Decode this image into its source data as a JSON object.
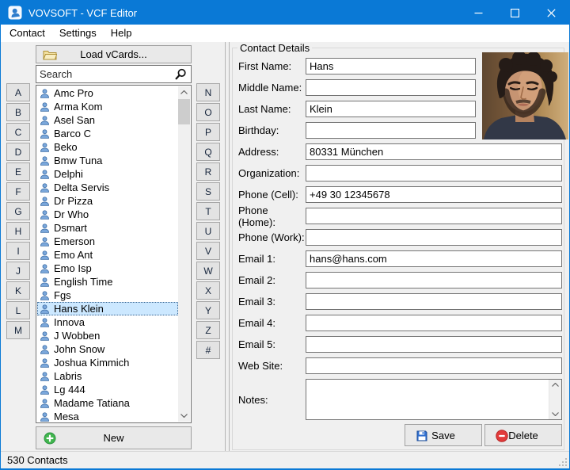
{
  "window": {
    "title": "VOVSOFT - VCF Editor",
    "accent_color": "#0a79d6"
  },
  "menu": {
    "items": [
      {
        "label": "Contact"
      },
      {
        "label": "Settings"
      },
      {
        "label": "Help"
      }
    ]
  },
  "sidebar": {
    "load_button": "Load vCards...",
    "search_placeholder": "Search",
    "new_button": "New",
    "alphabet_left": [
      "A",
      "B",
      "C",
      "D",
      "E",
      "F",
      "G",
      "H",
      "I",
      "J",
      "K",
      "L",
      "M"
    ],
    "alphabet_right": [
      "N",
      "O",
      "P",
      "Q",
      "R",
      "S",
      "T",
      "U",
      "V",
      "W",
      "X",
      "Y",
      "Z",
      "#"
    ]
  },
  "contacts": {
    "selected": "Hans Klein",
    "next_row_partial": true,
    "items": [
      "Amc Pro",
      "Arma Kom",
      "Asel San",
      "Barco C",
      "Beko",
      "Bmw Tuna",
      "Delphi",
      "Delta Servis",
      "Dr Pizza",
      "Dr Who",
      "Dsmart",
      "Emerson",
      "Emo Ant",
      "Emo Isp",
      "English Time",
      "Fgs",
      "Hans Klein",
      "Innova",
      "J Wobben",
      "John Snow",
      "Joshua Kimmich",
      "Labris",
      "Lg 444",
      "Madame Tatiana",
      "Mesa"
    ]
  },
  "form": {
    "group_title": "Contact Details",
    "save_label": "Save",
    "delete_label": "Delete",
    "fields": [
      {
        "label": "First Name:",
        "value": "Hans",
        "size": "short"
      },
      {
        "label": "Middle Name:",
        "value": "",
        "size": "short"
      },
      {
        "label": "Last Name:",
        "value": "Klein",
        "size": "short"
      },
      {
        "label": "Birthday:",
        "value": "",
        "size": "short"
      },
      {
        "label": "Address:",
        "value": "80331 München",
        "size": "long"
      },
      {
        "label": "Organization:",
        "value": "",
        "size": "long"
      },
      {
        "label": "Phone (Cell):",
        "value": "+49 30 12345678",
        "size": "long"
      },
      {
        "label": "Phone (Home):",
        "value": "",
        "size": "long"
      },
      {
        "label": "Phone (Work):",
        "value": "",
        "size": "long"
      },
      {
        "label": "Email 1:",
        "value": "hans@hans.com",
        "size": "long"
      },
      {
        "label": "Email 2:",
        "value": "",
        "size": "long"
      },
      {
        "label": "Email 3:",
        "value": "",
        "size": "long"
      },
      {
        "label": "Email 4:",
        "value": "",
        "size": "long"
      },
      {
        "label": "Email 5:",
        "value": "",
        "size": "long"
      },
      {
        "label": "Web Site:",
        "value": "",
        "size": "long"
      },
      {
        "label": "Notes:",
        "value": "",
        "size": "textarea"
      }
    ]
  },
  "photo": {
    "description": "portrait of a man with dark curly hair and beard"
  },
  "statusbar": {
    "text": "530 Contacts"
  },
  "icons": {
    "app": "person-badge-icon",
    "load": "open-folder-icon",
    "search": "magnifier-icon",
    "contact": "person-icon",
    "new": "green-plus-icon",
    "save": "floppy-disk-icon",
    "delete": "red-minus-icon"
  },
  "colors": {
    "titlebar": "#0a79d6",
    "selection": "#cce8ff",
    "panel": "#f0f0f0",
    "person_icon": "#7aa7db"
  }
}
